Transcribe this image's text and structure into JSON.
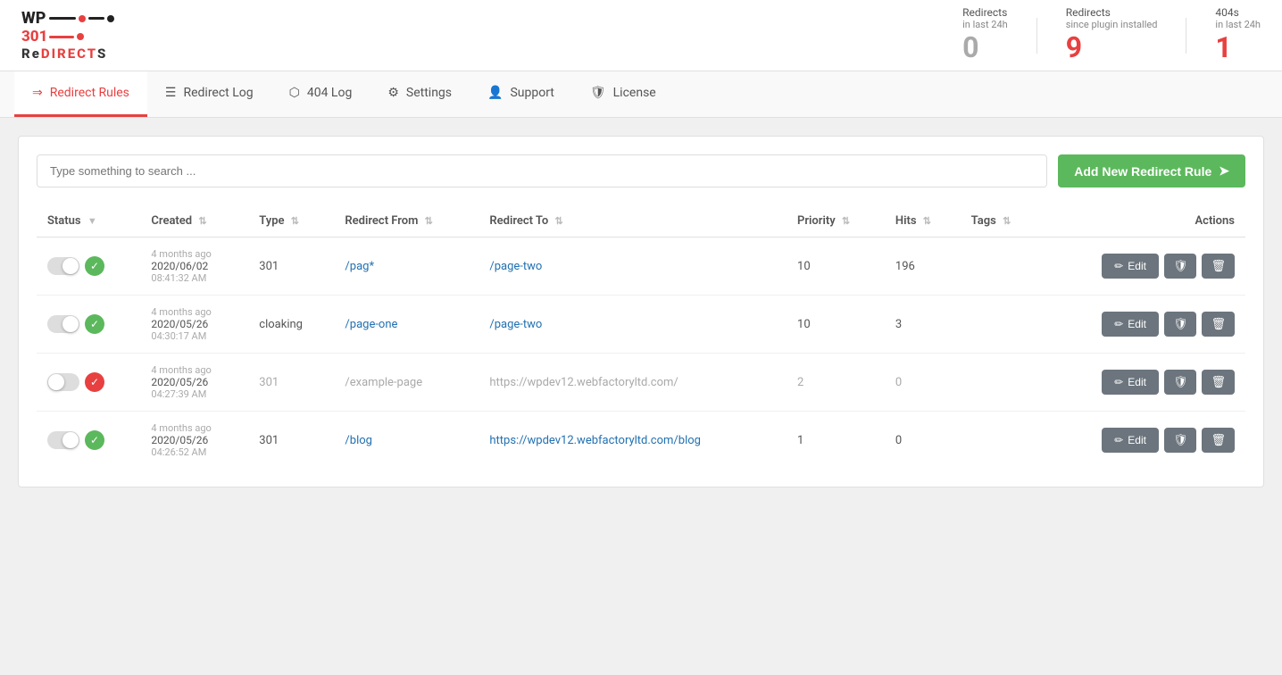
{
  "header": {
    "logo_wp": "WP",
    "logo_301": "301",
    "logo_redirects": "ReDIRECTS",
    "stats": [
      {
        "label": "Redirects",
        "sublabel": "in last 24h",
        "value": "0",
        "color": "normal"
      },
      {
        "label": "Redirects",
        "sublabel": "since plugin installed",
        "value": "9",
        "color": "orange"
      },
      {
        "label": "404s",
        "sublabel": "in last 24h",
        "value": "1",
        "color": "orange"
      }
    ]
  },
  "nav": {
    "tabs": [
      {
        "id": "redirect-rules",
        "label": "Redirect Rules",
        "icon": "⇒",
        "active": true
      },
      {
        "id": "redirect-log",
        "label": "Redirect Log",
        "icon": "☰",
        "active": false
      },
      {
        "id": "404-log",
        "label": "404 Log",
        "icon": "⬡",
        "active": false
      },
      {
        "id": "settings",
        "label": "Settings",
        "icon": "⚙",
        "active": false
      },
      {
        "id": "support",
        "label": "Support",
        "icon": "👤",
        "active": false
      },
      {
        "id": "license",
        "label": "License",
        "icon": "🛡",
        "active": false
      }
    ]
  },
  "toolbar": {
    "search_placeholder": "Type something to search ...",
    "add_button_label": "Add New Redirect Rule"
  },
  "table": {
    "columns": [
      {
        "id": "status",
        "label": "Status",
        "sortable": true
      },
      {
        "id": "created",
        "label": "Created",
        "sortable": true
      },
      {
        "id": "type",
        "label": "Type",
        "sortable": true
      },
      {
        "id": "redirect_from",
        "label": "Redirect From",
        "sortable": true
      },
      {
        "id": "redirect_to",
        "label": "Redirect To",
        "sortable": true
      },
      {
        "id": "priority",
        "label": "Priority",
        "sortable": true
      },
      {
        "id": "hits",
        "label": "Hits",
        "sortable": true
      },
      {
        "id": "tags",
        "label": "Tags",
        "sortable": true
      },
      {
        "id": "actions",
        "label": "Actions",
        "sortable": false
      }
    ],
    "rows": [
      {
        "id": 1,
        "status": "on",
        "status_icon": "green",
        "ago": "4 months ago",
        "date": "2020/06/02",
        "time": "08:41:32 AM",
        "type": "301",
        "redirect_from": "/pag*",
        "redirect_to": "/page-two",
        "priority": "10",
        "hits": "196",
        "tags": "",
        "muted": false
      },
      {
        "id": 2,
        "status": "on",
        "status_icon": "green",
        "ago": "4 months ago",
        "date": "2020/05/26",
        "time": "04:30:17 AM",
        "type": "cloaking",
        "redirect_from": "/page-one",
        "redirect_to": "/page-two",
        "priority": "10",
        "hits": "3",
        "tags": "",
        "muted": false
      },
      {
        "id": 3,
        "status": "off",
        "status_icon": "red",
        "ago": "4 months ago",
        "date": "2020/05/26",
        "time": "04:27:39 AM",
        "type": "301",
        "redirect_from": "/example-page",
        "redirect_to": "https://wpdev12.webfactoryltd.com/",
        "priority": "2",
        "hits": "0",
        "tags": "",
        "muted": true
      },
      {
        "id": 4,
        "status": "on",
        "status_icon": "green",
        "ago": "4 months ago",
        "date": "2020/05/26",
        "time": "04:26:52 AM",
        "type": "301",
        "redirect_from": "/blog",
        "redirect_to": "https://wpdev12.webfactoryltd.com/blog",
        "priority": "1",
        "hits": "0",
        "tags": "",
        "muted": false
      }
    ]
  },
  "buttons": {
    "edit_label": "Edit",
    "shield_icon": "🛡",
    "trash_icon": "🗑",
    "pencil_icon": "✏"
  }
}
